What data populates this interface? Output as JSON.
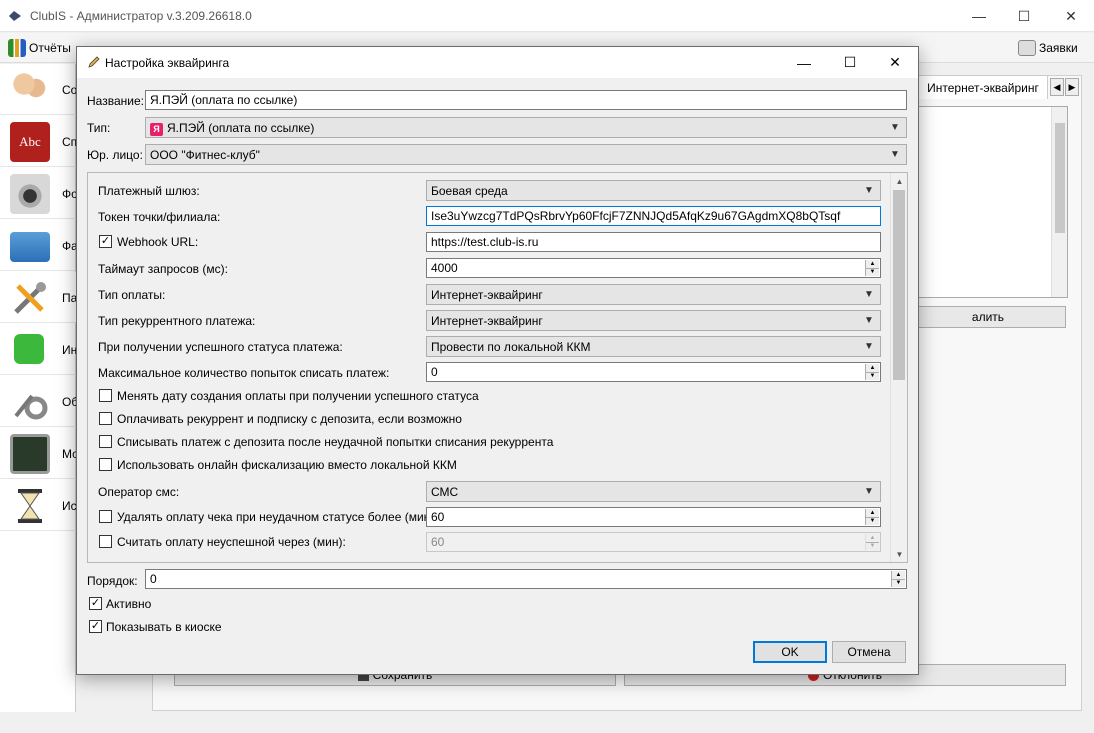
{
  "app": {
    "title": "ClubIS - Администратор v.3.209.26618.0",
    "toolbar": {
      "reports": "Отчёты",
      "requests": "Заявки"
    },
    "sidebar": [
      {
        "label": "Со",
        "icon": "users-icon"
      },
      {
        "label": "Сп",
        "icon": "book-icon"
      },
      {
        "label": "Фо",
        "icon": "camera-icon"
      },
      {
        "label": "Фа",
        "icon": "folder-icon"
      },
      {
        "label": "Па",
        "icon": "tools-icon"
      },
      {
        "label": "Ин",
        "icon": "puzzle-icon"
      },
      {
        "label": "Об",
        "icon": "gears-icon"
      },
      {
        "label": "Мо",
        "icon": "monitor-icon"
      },
      {
        "label": "Ис",
        "icon": "hourglass-icon"
      }
    ],
    "background": {
      "tab_label": "Интернет-эквайринг",
      "delete_btn": "алить",
      "save_btn": "Сохранить",
      "reject_btn": "Отклонить"
    }
  },
  "dialog": {
    "title": "Настройка эквайринга",
    "name_label": "Название:",
    "name_value": "Я.ПЭЙ (оплата по ссылке)",
    "type_label": "Тип:",
    "type_value": "Я.ПЭЙ (оплата по ссылке)",
    "legal_label": "Юр. лицо:",
    "legal_value": "ООО \"Фитнес-клуб\"",
    "settings": {
      "gateway_label": "Платежный шлюз:",
      "gateway_value": "Боевая среда",
      "token_label": "Токен точки/филиала:",
      "token_value": "Ise3uYwzcg7TdPQsRbrvYp60FfcjF7ZNNJQd5AfqKz9u67GAgdmXQ8bQTsqf",
      "webhook_label": "Webhook URL:",
      "webhook_checked": true,
      "webhook_value": "https://test.club-is.ru",
      "timeout_label": "Таймаут запросов (мс):",
      "timeout_value": "4000",
      "pay_type_label": "Тип оплаты:",
      "pay_type_value": "Интернет-эквайринг",
      "recurrent_type_label": "Тип рекуррентного платежа:",
      "recurrent_type_value": "Интернет-эквайринг",
      "on_success_label": "При получении успешного статуса платежа:",
      "on_success_value": "Провести по локальной ККМ",
      "max_attempts_label": "Максимальное количество попыток списать платеж:",
      "max_attempts_value": "0",
      "cb_change_date": "Менять дату создания оплаты при получении успешного статуса",
      "cb_pay_deposit": "Оплачивать рекуррент и подписку с депозита, если возможно",
      "cb_charge_deposit": "Списывать платеж с депозита после неудачной попытки списания рекуррента",
      "cb_online_fiscal": "Использовать онлайн фискализацию вместо локальной ККМ",
      "sms_operator_label": "Оператор смс:",
      "sms_operator_value": "СМС",
      "delete_check_label": "Удалять оплату чека при неудачном статусе более (мин):",
      "delete_check_value": "60",
      "unsuccess_label": "Считать оплату неуспешной через (мин):",
      "unsuccess_value": "60"
    },
    "order_label": "Порядок:",
    "order_value": "0",
    "active_label": "Активно",
    "active_checked": true,
    "kiosk_label": "Показывать в киоске",
    "kiosk_checked": true,
    "ok_btn": "OK",
    "cancel_btn": "Отмена"
  }
}
